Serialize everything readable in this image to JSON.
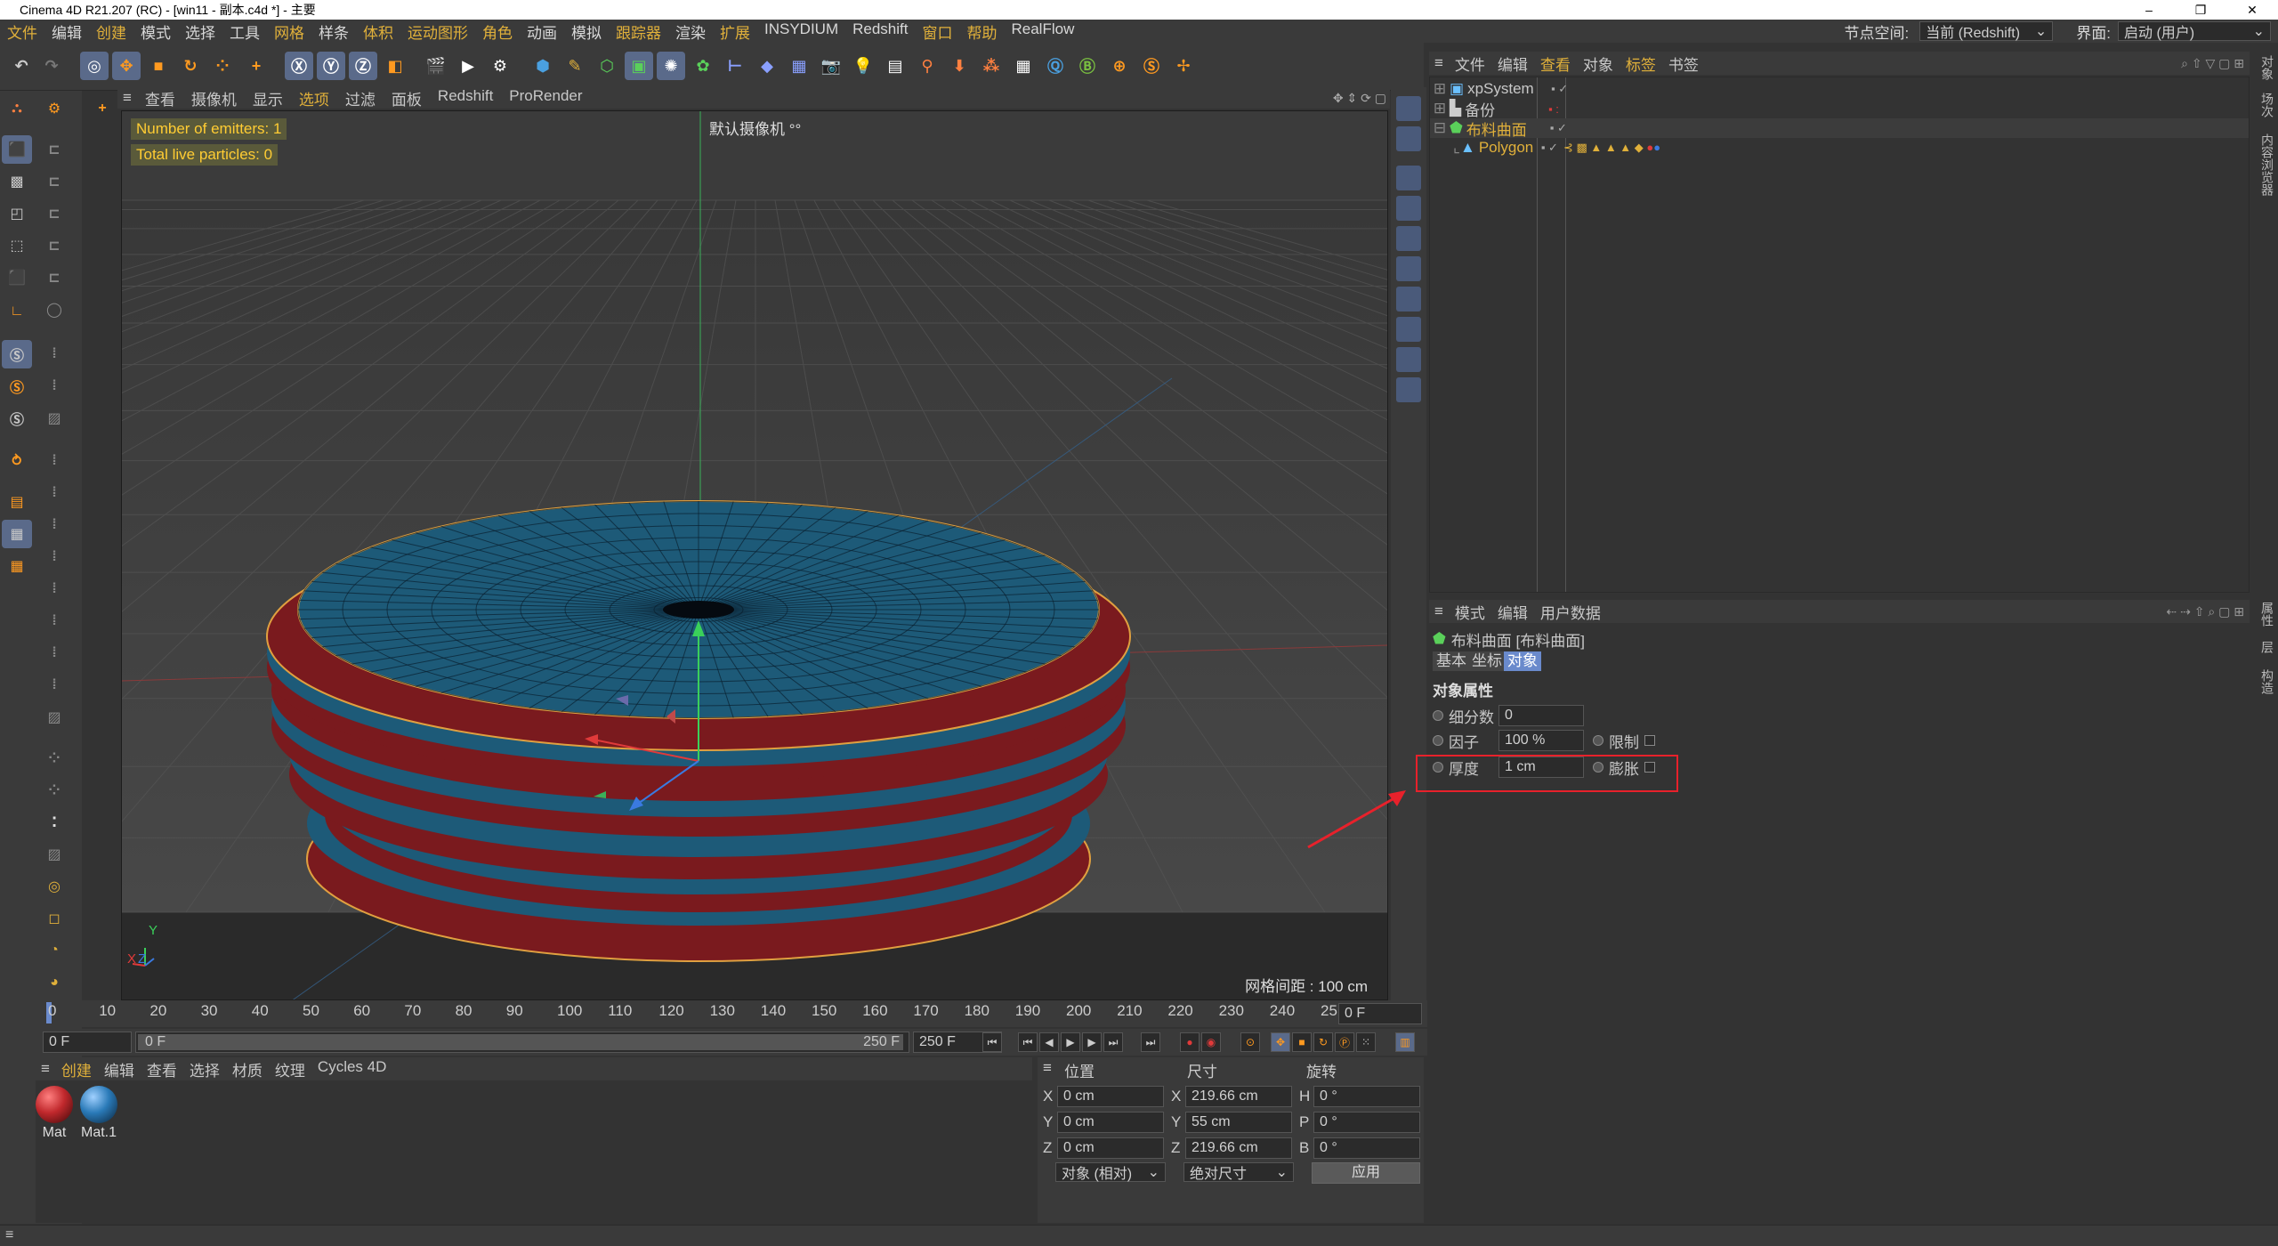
{
  "window": {
    "title": "Cinema 4D R21.207 (RC) - [win11 - 副本.c4d *] - 主要",
    "controls": [
      "–",
      "❐",
      "✕"
    ]
  },
  "menu": {
    "items": [
      "文件",
      "编辑",
      "创建",
      "模式",
      "选择",
      "工具",
      "网格",
      "样条",
      "体积",
      "运动图形",
      "角色",
      "动画",
      "模拟",
      "跟踪器",
      "渲染",
      "扩展",
      "INSYDIUM",
      "Redshift",
      "窗口",
      "帮助",
      "RealFlow"
    ],
    "highlighted": [
      0,
      2,
      6,
      8,
      9,
      10,
      13,
      15,
      18,
      19
    ],
    "node_space_label": "节点空间:",
    "node_space_value": "当前 (Redshift)",
    "layout_label": "界面:",
    "layout_value": "启动 (用户)"
  },
  "viewport": {
    "menu": [
      "查看",
      "摄像机",
      "显示",
      "选项",
      "过滤",
      "面板",
      "Redshift",
      "ProRender"
    ],
    "highlighted_menu": 3,
    "hud_emitters": "Number of emitters: 1",
    "hud_particles": "Total live particles: 0",
    "camera_label": "默认摄像机 °°",
    "grid_spacing": "网格间距 : 100 cm",
    "axis_y": "Y",
    "axis_x": "X",
    "axis_z": "Z",
    "colors": {
      "blue": "#1d5a78",
      "red": "#7a1a1e",
      "outline": "#e0a040"
    }
  },
  "timeline": {
    "ticks": [
      "0",
      "10",
      "20",
      "30",
      "40",
      "50",
      "60",
      "70",
      "80",
      "90",
      "100",
      "110",
      "120",
      "130",
      "140",
      "150",
      "160",
      "170",
      "180",
      "190",
      "200",
      "210",
      "220",
      "230",
      "240",
      "25"
    ],
    "current_frame": "0 F",
    "start": "0 F",
    "range_start": "0 F",
    "range_end": "250 F",
    "end": "250 F"
  },
  "materials": {
    "menu": [
      "创建",
      "编辑",
      "查看",
      "选择",
      "材质",
      "纹理",
      "Cycles 4D"
    ],
    "items": [
      {
        "name": "Mat",
        "color": "#c0282c"
      },
      {
        "name": "Mat.1",
        "color": "#2a7ab8"
      }
    ]
  },
  "coords": {
    "headers": {
      "pos": "位置",
      "size": "尺寸",
      "rot": "旋转"
    },
    "rows": [
      {
        "axis": "X",
        "pos": "0 cm",
        "saxis": "X",
        "size": "219.66 cm",
        "raxis": "H",
        "rot": "0 °"
      },
      {
        "axis": "Y",
        "pos": "0 cm",
        "saxis": "Y",
        "size": "55 cm",
        "raxis": "P",
        "rot": "0 °"
      },
      {
        "axis": "Z",
        "pos": "0 cm",
        "saxis": "Z",
        "size": "219.66 cm",
        "raxis": "B",
        "rot": "0 °"
      }
    ],
    "mode": "对象 (相对)",
    "size_mode": "绝对尺寸",
    "apply": "应用"
  },
  "objects": {
    "menu": [
      "文件",
      "编辑",
      "查看",
      "对象",
      "标签",
      "书签"
    ],
    "highlighted_menu": [
      2,
      4
    ],
    "items": [
      {
        "name": "xpSystem",
        "color": "#d0d0d0"
      },
      {
        "name": "备份",
        "color": "#d0d0d0"
      },
      {
        "name": "布料曲面",
        "color": "#e0b03a"
      },
      {
        "name": "Polygon",
        "color": "#e0b03a"
      }
    ]
  },
  "attributes": {
    "menu": [
      "模式",
      "编辑",
      "用户数据"
    ],
    "object_title": "布料曲面 [布料曲面]",
    "tabs": [
      "基本",
      "坐标",
      "对象"
    ],
    "active_tab": 2,
    "section": "对象属性",
    "subdivisions_label": "细分数",
    "subdivisions_value": "0",
    "factor_label": "因子",
    "factor_value": "100 %",
    "limit_label": "限制",
    "thickness_label": "厚度",
    "thickness_value": "1 cm",
    "expand_label": "膨胀"
  },
  "side_tabs": [
    "对象",
    "场次",
    "内容浏览器",
    "属性",
    "层",
    "构造"
  ]
}
